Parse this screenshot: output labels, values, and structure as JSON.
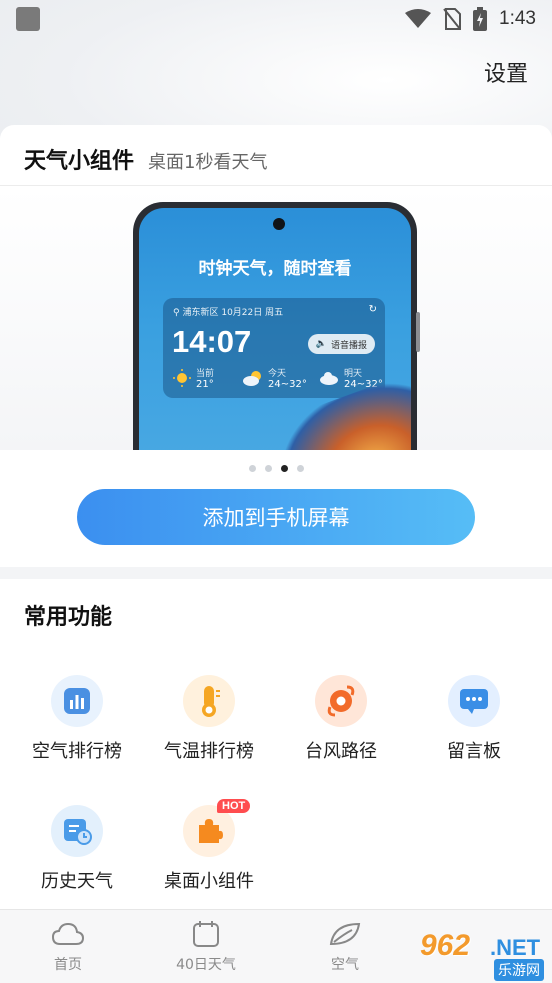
{
  "status_bar": {
    "time": "1:43"
  },
  "header": {
    "settings_label": "设置"
  },
  "widget_card": {
    "title": "天气小组件",
    "subtitle": "桌面1秒看天气",
    "preview": {
      "slogan": "时钟天气，随时查看",
      "location": "浦东新区",
      "date": "10月22日 周五",
      "time": "14:07",
      "voice_label": "语音播报",
      "forecast": [
        {
          "label": "当前",
          "temp": "21°",
          "icon": "sun-icon"
        },
        {
          "label": "今天",
          "temp": "24~32°",
          "icon": "partly-cloudy-icon"
        },
        {
          "label": "明天",
          "temp": "24~32°",
          "icon": "cloud-icon"
        }
      ]
    },
    "carousel": {
      "page_count": 4,
      "active_index": 2
    },
    "add_button_label": "添加到手机屏幕"
  },
  "functions": {
    "title": "常用功能",
    "items": [
      {
        "label": "空气排行榜",
        "icon": "chart-icon",
        "color": "#4a90e2"
      },
      {
        "label": "气温排行榜",
        "icon": "thermometer-icon",
        "color": "#f5a623"
      },
      {
        "label": "台风路径",
        "icon": "typhoon-icon",
        "color": "#f26b2a"
      },
      {
        "label": "留言板",
        "icon": "message-icon",
        "color": "#3a8ee6"
      },
      {
        "label": "历史天气",
        "icon": "history-icon",
        "color": "#4a9be8"
      },
      {
        "label": "桌面小组件",
        "icon": "puzzle-icon",
        "color": "#f58a1f",
        "badge": "HOT"
      }
    ]
  },
  "tab_bar": {
    "items": [
      {
        "label": "首页",
        "icon": "cloud-outline-icon"
      },
      {
        "label": "40日天气",
        "icon": "calendar-icon"
      },
      {
        "label": "空气",
        "icon": "leaf-icon"
      }
    ]
  },
  "watermark": {
    "number": "962",
    "suffix": ".NET",
    "cn_text": "乐游网"
  }
}
